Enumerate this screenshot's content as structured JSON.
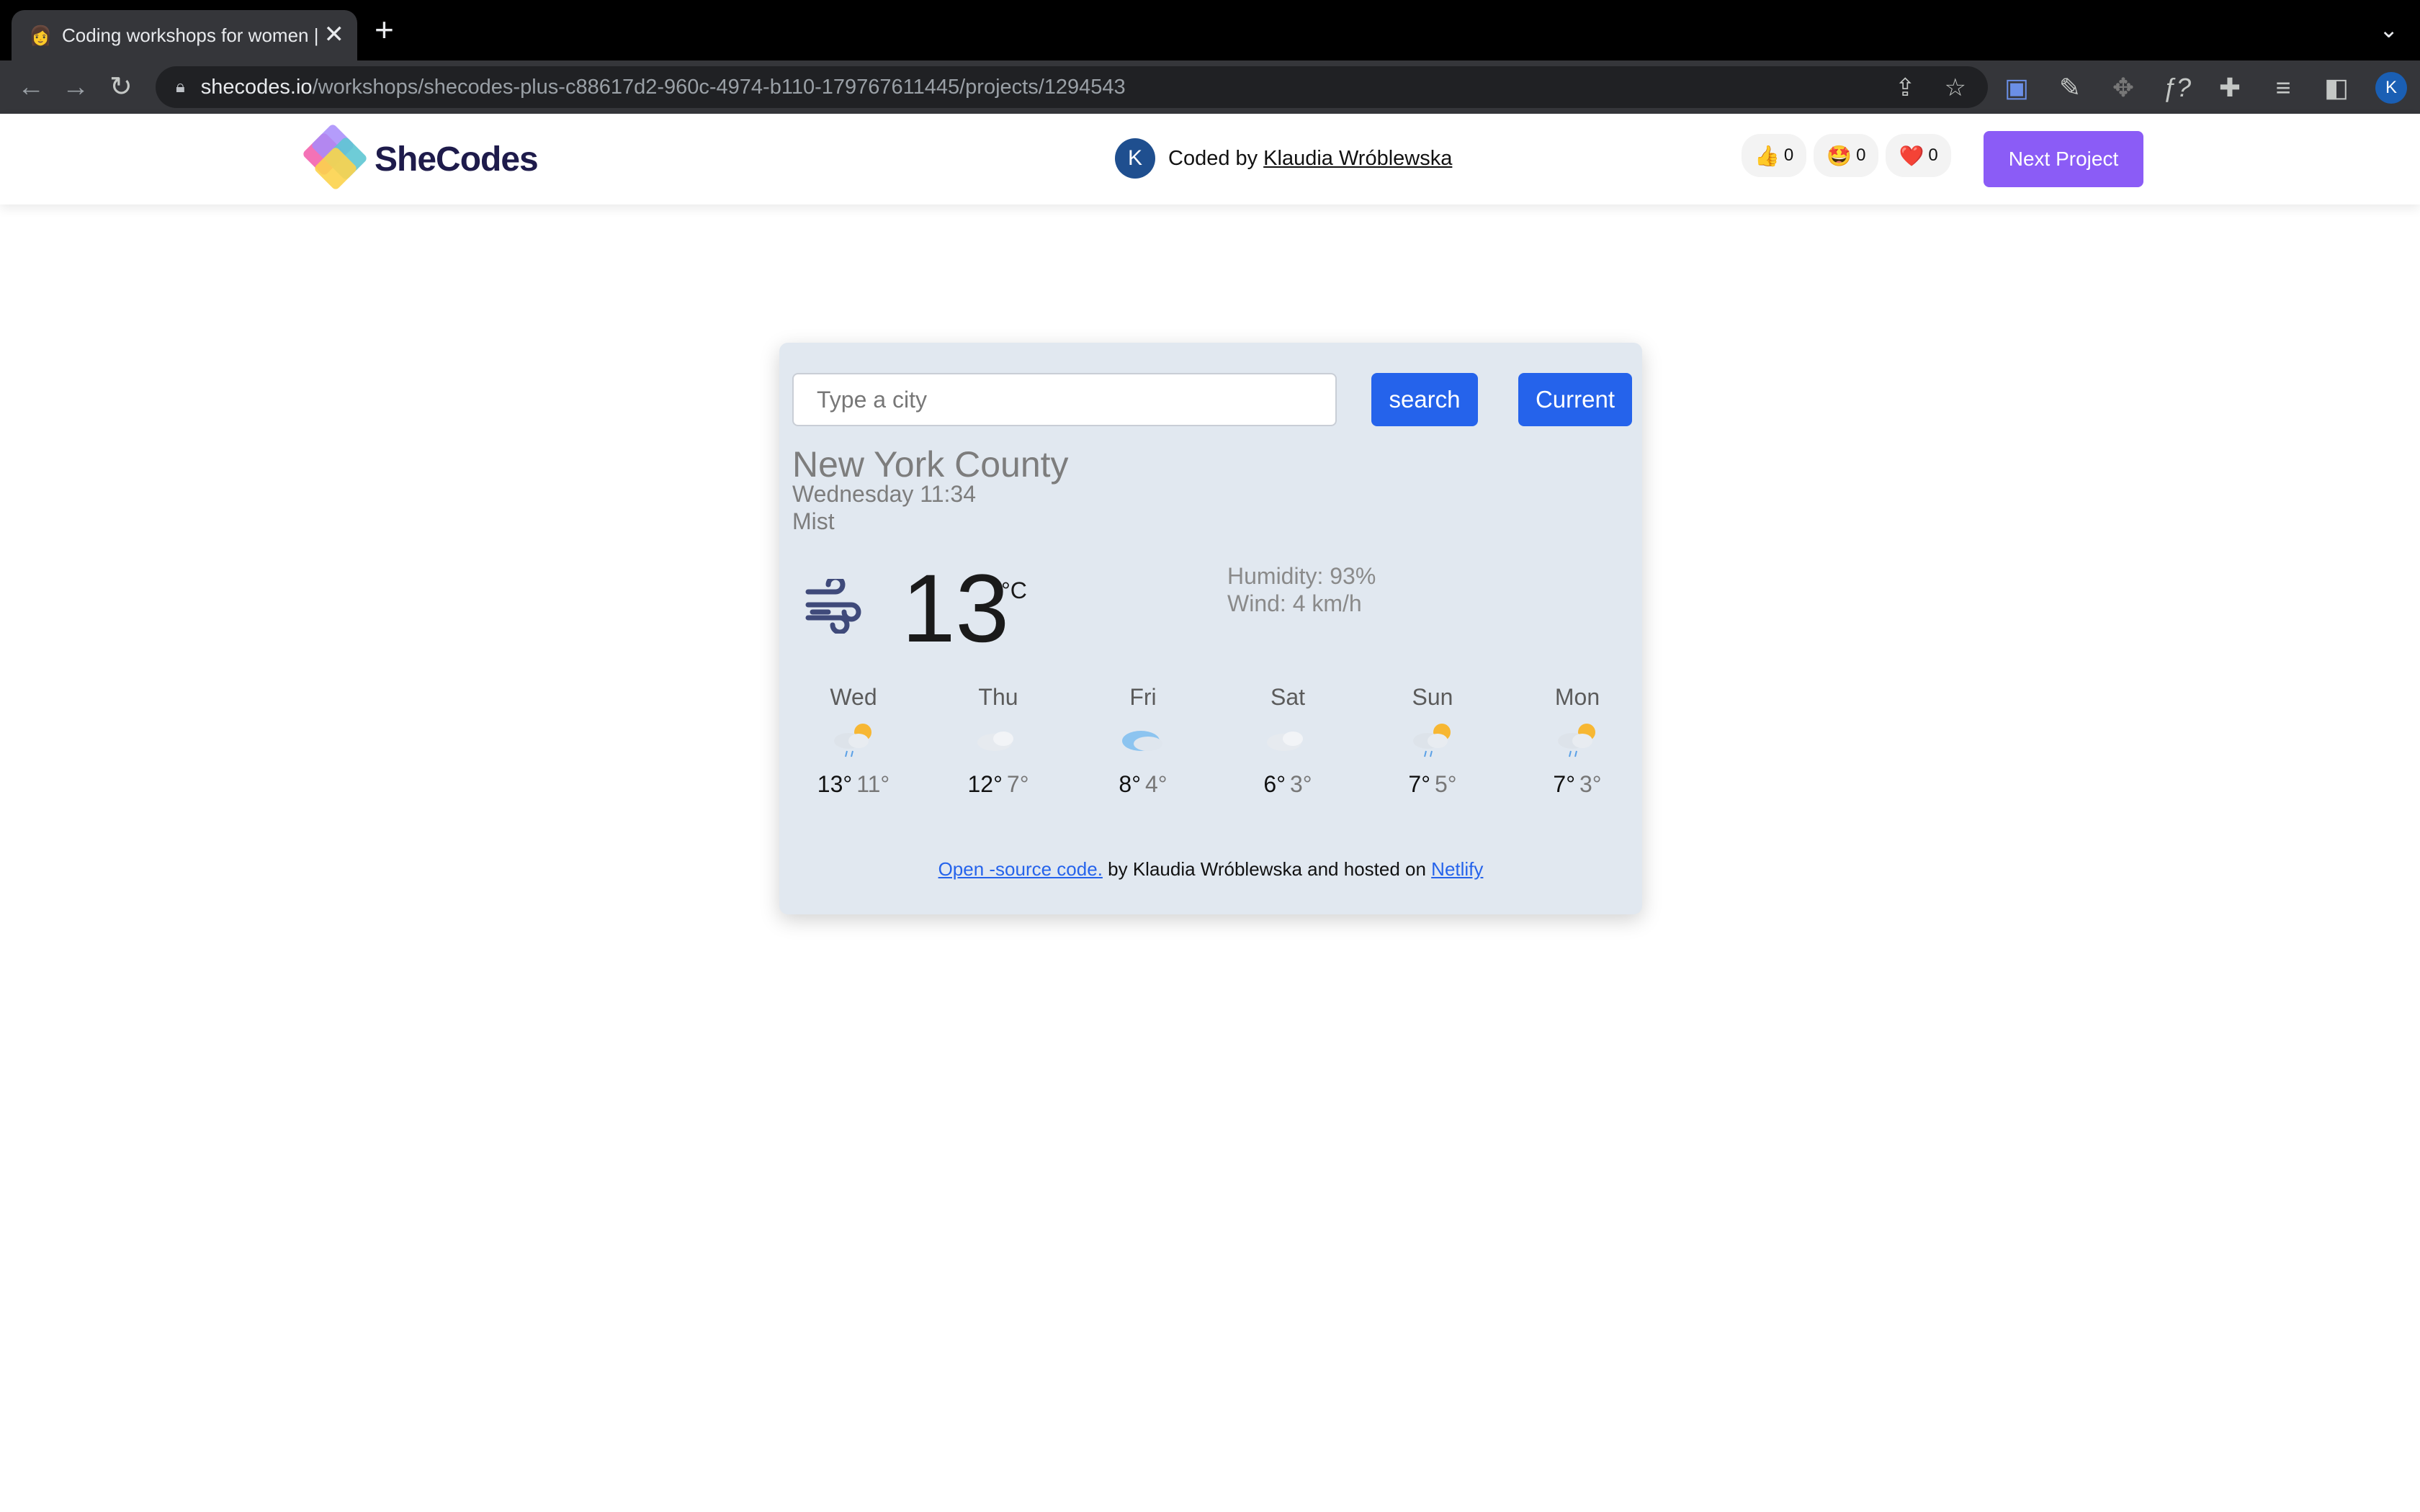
{
  "browser": {
    "tab_title": "Coding workshops for women |",
    "tab_close": "✕",
    "new_tab": "+",
    "url_host": "shecodes.io",
    "url_path": "/workshops/shecodes-plus-c88617d2-960c-4974-b110-179767611445/projects/1294543",
    "profile_initial": "K"
  },
  "header": {
    "logo_text": "SheCodes",
    "author_initial": "K",
    "coded_by_label": "Coded by",
    "author_name": "Klaudia Wróblewska",
    "reactions": [
      {
        "emoji": "👍",
        "count": "0"
      },
      {
        "emoji": "🤩",
        "count": "0"
      },
      {
        "emoji": "❤️",
        "count": "0"
      }
    ],
    "next_project_label": "Next Project"
  },
  "weather": {
    "search_placeholder": "Type a city",
    "search_label": "search",
    "current_label": "Current",
    "city": "New York County",
    "datetime": "Wednesday 11:34",
    "condition": "Mist",
    "temperature": "13",
    "unit": "°C",
    "humidity": "Humidity: 93%",
    "wind": "Wind: 4 km/h",
    "forecast": [
      {
        "day": "Wed",
        "icon": "rain-sun-icon",
        "max": "13°",
        "min": "11°"
      },
      {
        "day": "Thu",
        "icon": "cloud-icon",
        "max": "12°",
        "min": "7°"
      },
      {
        "day": "Fri",
        "icon": "cloud-blue-icon",
        "max": "8°",
        "min": "4°"
      },
      {
        "day": "Sat",
        "icon": "cloud-icon",
        "max": "6°",
        "min": "3°"
      },
      {
        "day": "Sun",
        "icon": "rain-sun-icon",
        "max": "7°",
        "min": "5°"
      },
      {
        "day": "Mon",
        "icon": "rain-sun-icon",
        "max": "7°",
        "min": "3°"
      }
    ],
    "footer_link1": "Open -source code.",
    "footer_text": " by Klaudia Wróblewska and hosted on ",
    "footer_link2": "Netlify"
  },
  "colors": {
    "accent_blue": "#2563eb",
    "next_project_purple": "#8b5cf6",
    "card_bg": "#e1e8f0"
  }
}
